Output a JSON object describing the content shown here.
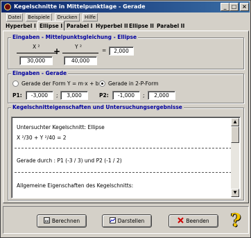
{
  "window": {
    "title": "Kegelschnitte in Mittelpunktlage - Gerade"
  },
  "menu": {
    "items": [
      "Datei",
      "Beispiele",
      "Drucken",
      "Hilfe"
    ]
  },
  "tabs": [
    "Hyperbel I",
    "Ellipse I",
    "Parabel I",
    "Hyperbel II",
    "Ellipse II",
    "Parabel II"
  ],
  "active_tab": "Ellipse I",
  "equation_group": {
    "title": "Eingaben - Mittelpunktsgleichung - Ellipse",
    "numerator_x": "X ²",
    "numerator_y": "Y ²",
    "plus": "+",
    "equals": "=",
    "denominator_x": "30,000",
    "denominator_y": "40,000",
    "rhs": "2,000"
  },
  "line_group": {
    "title": "Eingaben - Gerade",
    "option_1": "Gerade der Form Y = m·x + b",
    "option_2": "Gerade in 2-P-Form",
    "selected": "option_2",
    "p1_label": "P1:",
    "p1_x": "-3,000",
    "p1_y": "3,000",
    "p2_label": "P2:",
    "p2_x": "-1,000",
    "p2_y": "2,000",
    "separator": ";"
  },
  "results_group": {
    "title": "Kegelschnitteigenschaften und Untersuchungsergebnisse",
    "lines": [
      "Untersuchter Kegelschnitt: Ellipse",
      "X ²/30 + Y ²/40 = 2",
      "Gerade durch : P1 (-3 / 3) und P2 (-1 / 2)",
      "Allgemeine Eigenschaften des Kegelschnitts:"
    ]
  },
  "buttons": {
    "calculate": "Berechnen",
    "draw": "Darstellen",
    "quit": "Beenden",
    "help": "?"
  }
}
